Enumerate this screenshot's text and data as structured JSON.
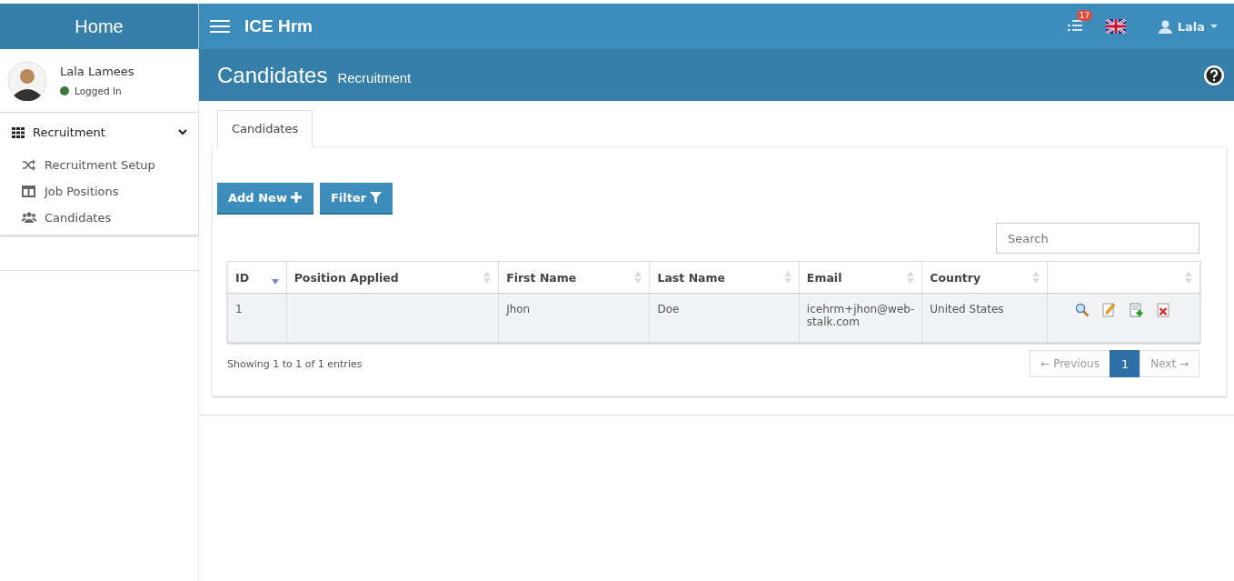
{
  "sidebar": {
    "brand": "Home",
    "user": {
      "name": "Lala Lamees",
      "status": "Logged In",
      "online": true
    },
    "menu": [
      {
        "label": "Recruitment",
        "expanded": true,
        "children": [
          {
            "label": "Recruitment Setup"
          },
          {
            "label": "Job Positions"
          },
          {
            "label": "Candidates"
          }
        ]
      }
    ]
  },
  "header": {
    "title": "ICE Hrm",
    "notifications": "17",
    "user": "Lala"
  },
  "page": {
    "title": "Candidates",
    "subtitle": "Recruitment"
  },
  "tabs": [
    {
      "label": "Candidates",
      "selected": true
    }
  ],
  "buttons": [
    {
      "label": "Add New"
    },
    {
      "label": "Filter"
    }
  ],
  "search": {
    "placeholder": "Search"
  },
  "table": {
    "columns": [
      {
        "label": "ID",
        "sorted": true
      },
      {
        "label": "Position Applied",
        "sorted": false
      },
      {
        "label": "First Name",
        "sorted": false
      },
      {
        "label": "Last Name",
        "sorted": false
      },
      {
        "label": "Email",
        "sorted": false
      },
      {
        "label": "Country",
        "sorted": false
      },
      {
        "sorted": false
      }
    ],
    "rows": [
      {
        "cells": [
          "1",
          "",
          "Jhon",
          "Doe",
          "icehrm+jhon@web-stalk.com",
          "United States"
        ]
      }
    ]
  },
  "info": "Showing 1 to 1 of 1 entries",
  "pagination": [
    {
      "label": "← Previous",
      "disabled": true,
      "selected": false
    },
    {
      "label": "1",
      "disabled": false,
      "selected": true
    },
    {
      "label": "Next →",
      "disabled": true,
      "selected": false
    }
  ]
}
